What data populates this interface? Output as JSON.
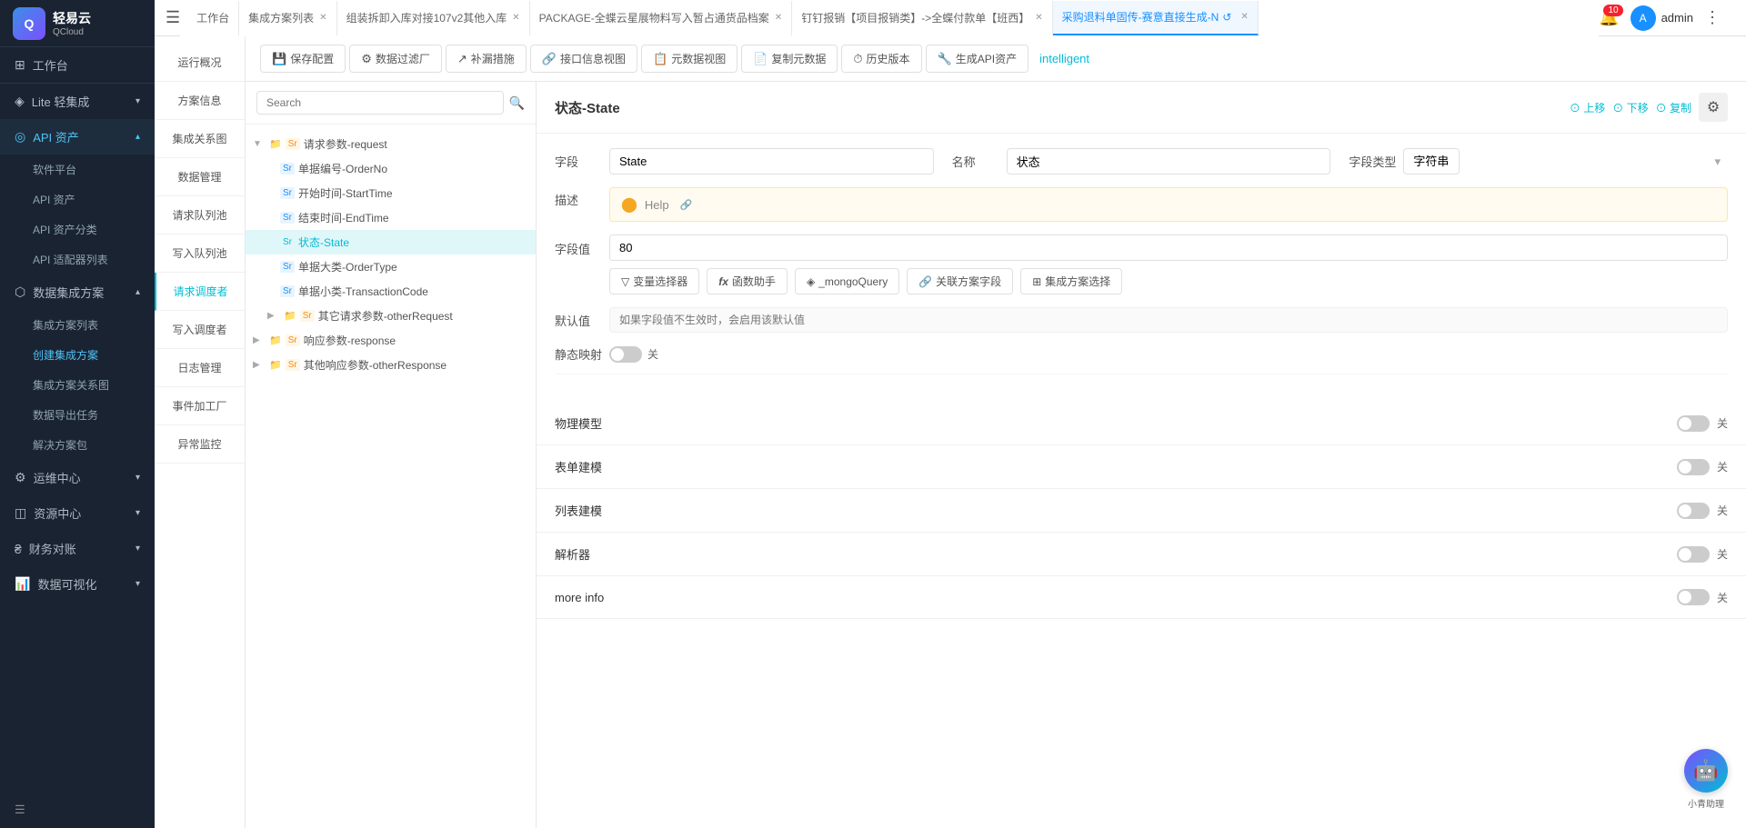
{
  "app": {
    "logo_text": "轻易云",
    "logo_sub": "QCloud",
    "logo_abbr": "Q"
  },
  "sidebar": {
    "items": [
      {
        "id": "workspace",
        "label": "工作台",
        "icon": "⊞",
        "has_arrow": false
      },
      {
        "id": "lite",
        "label": "Lite 轻集成",
        "icon": "◈",
        "has_arrow": true
      },
      {
        "id": "api",
        "label": "API 资产",
        "icon": "◎",
        "has_arrow": true,
        "active": true
      },
      {
        "id": "data-integration",
        "label": "数据集成方案",
        "icon": "⬡",
        "has_arrow": true,
        "expanded": true
      },
      {
        "id": "ops",
        "label": "运维中心",
        "icon": "⚙",
        "has_arrow": true
      },
      {
        "id": "resources",
        "label": "资源中心",
        "icon": "◫",
        "has_arrow": true
      },
      {
        "id": "finance",
        "label": "财务对账",
        "icon": "₴",
        "has_arrow": true
      },
      {
        "id": "dataviz",
        "label": "数据可视化",
        "icon": "📊",
        "has_arrow": true
      }
    ],
    "api_sub_items": [
      {
        "id": "software",
        "label": "软件平台"
      },
      {
        "id": "api-assets",
        "label": "API 资产"
      },
      {
        "id": "api-classify",
        "label": "API 资产分类"
      },
      {
        "id": "api-adapter",
        "label": "API 适配器列表"
      }
    ],
    "data_sub_items": [
      {
        "id": "solution-list",
        "label": "集成方案列表"
      },
      {
        "id": "create-solution",
        "label": "创建集成方案",
        "active": true
      },
      {
        "id": "solution-graph",
        "label": "集成方案关系图"
      },
      {
        "id": "data-export",
        "label": "数据导出任务"
      },
      {
        "id": "solution-package",
        "label": "解决方案包"
      }
    ]
  },
  "tabs": [
    {
      "id": "workspace",
      "label": "工作台",
      "closable": false
    },
    {
      "id": "solution-list",
      "label": "集成方案列表",
      "closable": true
    },
    {
      "id": "combine-entry",
      "label": "组装拆卸入库对接107v2其他入库",
      "closable": true
    },
    {
      "id": "package",
      "label": "PACKAGE-全蝶云星展物料写入暂占通货品档案",
      "closable": true
    },
    {
      "id": "nailding",
      "label": "钉钉报销【项目报销类】->全蝶付款单【班西】",
      "closable": true
    },
    {
      "id": "purchase",
      "label": "采购退料单固传-赛意直接生成-N",
      "closable": true,
      "active": true
    }
  ],
  "left_nav": [
    {
      "id": "run-overview",
      "label": "运行概况"
    },
    {
      "id": "solution-info",
      "label": "方案信息"
    },
    {
      "id": "graph",
      "label": "集成关系图"
    },
    {
      "id": "data-mgmt",
      "label": "数据管理"
    },
    {
      "id": "request-queue",
      "label": "请求队列池"
    },
    {
      "id": "write-queue",
      "label": "写入队列池"
    },
    {
      "id": "requester",
      "label": "请求调度者",
      "active": true
    },
    {
      "id": "writer",
      "label": "写入调度者"
    },
    {
      "id": "log-mgmt",
      "label": "日志管理"
    },
    {
      "id": "event-factory",
      "label": "事件加工厂"
    },
    {
      "id": "anomaly",
      "label": "异常监控"
    }
  ],
  "toolbar": {
    "buttons": [
      {
        "id": "save-config",
        "label": "保存配置",
        "icon": "💾"
      },
      {
        "id": "data-filter",
        "label": "数据过滤厂",
        "icon": "⚙"
      },
      {
        "id": "repair",
        "label": "补漏措施",
        "icon": "↗"
      },
      {
        "id": "interface-view",
        "label": "接口信息视图",
        "icon": "🔗"
      },
      {
        "id": "meta-view",
        "label": "元数据视图",
        "icon": "📋"
      },
      {
        "id": "copy-data",
        "label": "复制元数据",
        "icon": "📄"
      },
      {
        "id": "history",
        "label": "历史版本",
        "icon": "⏱"
      },
      {
        "id": "gen-api",
        "label": "生成API资产",
        "icon": "🔧"
      }
    ],
    "intelligent": "intelligent"
  },
  "tree": {
    "search_placeholder": "Search",
    "nodes": [
      {
        "id": "request-params",
        "label": "请求参数-request",
        "type": "folder",
        "level": 0,
        "expanded": true,
        "toggle": "▼"
      },
      {
        "id": "order-no",
        "label": "单据编号-OrderNo",
        "type": "str",
        "level": 1,
        "toggle": ""
      },
      {
        "id": "start-time",
        "label": "开始时间-StartTime",
        "type": "str",
        "level": 1,
        "toggle": ""
      },
      {
        "id": "end-time",
        "label": "结束时间-EndTime",
        "type": "str",
        "level": 1,
        "toggle": ""
      },
      {
        "id": "state",
        "label": "状态-State",
        "type": "str",
        "level": 1,
        "toggle": "",
        "active": true
      },
      {
        "id": "order-type",
        "label": "单据大类-OrderType",
        "type": "str",
        "level": 1,
        "toggle": ""
      },
      {
        "id": "transaction-code",
        "label": "单据小类-TransactionCode",
        "type": "str",
        "level": 1,
        "toggle": ""
      },
      {
        "id": "other-request",
        "label": "其它请求参数-otherRequest",
        "type": "folder",
        "level": 1,
        "toggle": "▶"
      },
      {
        "id": "response-params",
        "label": "响应参数-response",
        "type": "folder",
        "level": 0,
        "expanded": false,
        "toggle": "▶"
      },
      {
        "id": "other-response",
        "label": "其他响应参数-otherResponse",
        "type": "folder",
        "level": 0,
        "toggle": "▶"
      }
    ]
  },
  "detail": {
    "title": "状态-State",
    "actions": {
      "up": "上移",
      "down": "下移",
      "copy": "复制"
    },
    "field_label": "字段",
    "field_value": "State",
    "name_label": "名称",
    "name_value": "状态",
    "type_label": "字段类型",
    "type_value": "字符串",
    "desc_label": "描述",
    "help_text": "Help",
    "field_value_label": "字段值",
    "field_value_number": "80",
    "field_value_buttons": [
      {
        "id": "var-selector",
        "label": "变量选择器",
        "icon": "▽"
      },
      {
        "id": "func-helper",
        "label": "函数助手",
        "icon": "fx"
      },
      {
        "id": "mongo-query",
        "label": "_mongoQuery",
        "icon": "◈"
      },
      {
        "id": "link-field",
        "label": "关联方案字段",
        "icon": "🔗"
      },
      {
        "id": "solution-select",
        "label": "集成方案选择",
        "icon": "⊞"
      }
    ],
    "default_label": "默认值",
    "default_placeholder": "如果字段值不生效时，会启用该默认值",
    "static_map_label": "静态映射",
    "static_map_state": "关",
    "sections": [
      {
        "id": "physical-model",
        "label": "物理模型",
        "state": "关"
      },
      {
        "id": "form-model",
        "label": "表单建模",
        "state": "关"
      },
      {
        "id": "list-model",
        "label": "列表建模",
        "state": "关"
      },
      {
        "id": "parser",
        "label": "解析器",
        "state": "关"
      },
      {
        "id": "more-info",
        "label": "more info",
        "state": "关"
      }
    ]
  },
  "top_right": {
    "notifications": "10",
    "username": "admin"
  }
}
